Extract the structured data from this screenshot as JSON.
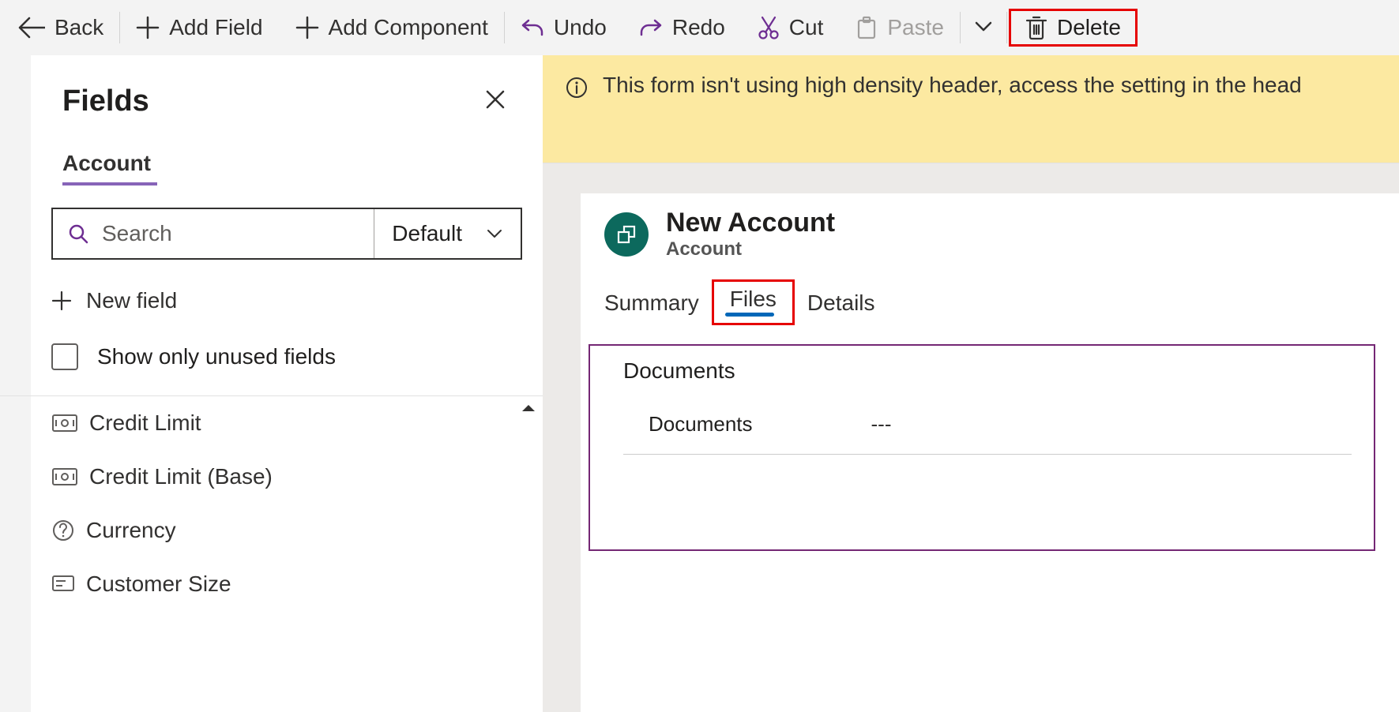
{
  "toolbar": {
    "back": "Back",
    "addField": "Add Field",
    "addComponent": "Add Component",
    "undo": "Undo",
    "redo": "Redo",
    "cut": "Cut",
    "paste": "Paste",
    "delete": "Delete"
  },
  "fieldsPanel": {
    "title": "Fields",
    "entityTab": "Account",
    "searchPlaceholder": "Search",
    "searchFilter": "Default",
    "newField": "New field",
    "showUnused": "Show only unused fields",
    "items": [
      "Credit Limit",
      "Credit Limit (Base)",
      "Currency",
      "Customer Size"
    ]
  },
  "banner": {
    "text": "This form isn't using high density header, access the setting in the head"
  },
  "form": {
    "title": "New Account",
    "subtitle": "Account",
    "tabs": [
      "Summary",
      "Files",
      "Details"
    ],
    "section": {
      "title": "Documents",
      "rowLabel": "Documents",
      "rowValue": "---"
    }
  }
}
